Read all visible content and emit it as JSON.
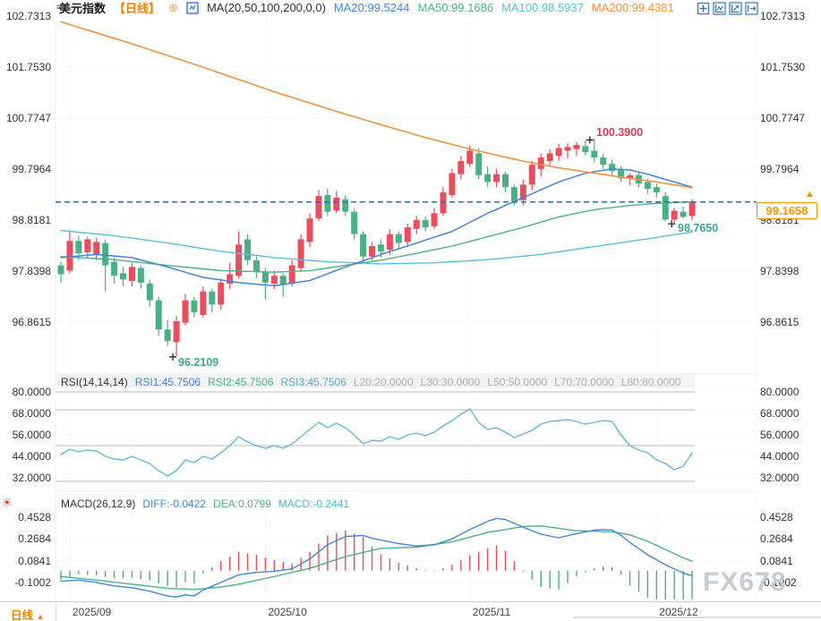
{
  "header": {
    "title": "美元指数",
    "period_tag": "【日线】",
    "ma_settings": "MA(20,50,100,200,0,0)",
    "ma20_label": "MA20:99.5244",
    "ma50_label": "MA50:99.1686",
    "ma100_label": "MA100:98.5937",
    "ma200_label": "MA200:99.4381"
  },
  "rsi_legend": {
    "name": "RSI(14,14,14)",
    "rsi1": "RSI1:45.7506",
    "rsi2": "RSI2:45.7506",
    "rsi3": "RSI3:45.7506",
    "l20": "L20:20.0000",
    "l30": "L30:30.0000",
    "l50": "L50:50.0000",
    "l70": "L70:70.0000",
    "l80": "L80:80.0000"
  },
  "macd_legend": {
    "name": "MACD(26,12,9)",
    "diff": "DIFF:-0.0422",
    "dea": "DEA:0.0799",
    "macd": "MACD:-0.2441"
  },
  "price_axis": {
    "ticks": [
      "102.7313",
      "101.7530",
      "100.7747",
      "99.7964",
      "98.8181",
      "97.8398",
      "96.8615"
    ]
  },
  "rsi_axis": {
    "ticks": [
      "80.0000",
      "68.0000",
      "56.0000",
      "44.0000",
      "32.0000"
    ]
  },
  "macd_axis": {
    "ticks": [
      "0.4528",
      "0.2684",
      "0.0841",
      "-0.1002"
    ]
  },
  "x_axis": {
    "labels": [
      "2025/09",
      "2025/10",
      "2025/11",
      "2025/12"
    ]
  },
  "bottom_bar": {
    "period": "日线",
    "arrow": "▲"
  },
  "annotations": {
    "current_price": "99.1658",
    "high": "100.3900",
    "low": "96.2109",
    "recent_low": "98.7650",
    "price_arrow": "▲",
    "live_icon": "☀",
    "menu_icon": "≡",
    "add_icon": "⊕"
  },
  "watermark": "FX678",
  "colors": {
    "up": "#ea4d5c",
    "down": "#4bb086",
    "ma20": "#4186e0",
    "ma50": "#4cb389",
    "ma100": "#5bbde6",
    "ma200": "#f5913d",
    "rsi": "#63b9dd",
    "diff": "#4186e0",
    "dea": "#4cb389",
    "current": "#1673e6",
    "grid": "#dcdcdc",
    "level": "#b8b8b8",
    "cross": "#222222"
  },
  "chart_data": {
    "type": "candlestick",
    "title": "美元指数 日线",
    "x_labels": [
      "2025/09",
      "2025/10",
      "2025/11",
      "2025/12"
    ],
    "x_label_indices": [
      1,
      23,
      46,
      67
    ],
    "price_ticks": [
      102.7313,
      101.753,
      100.7747,
      99.7964,
      98.8181,
      97.8398,
      96.8615
    ],
    "current_price": 99.1658,
    "candles": [
      [
        97.95,
        98.02,
        97.62,
        97.78
      ],
      [
        97.85,
        98.62,
        97.8,
        98.42
      ],
      [
        98.42,
        98.52,
        98.05,
        98.18
      ],
      [
        98.2,
        98.5,
        98.1,
        98.45
      ],
      [
        98.15,
        98.48,
        98.05,
        98.4
      ],
      [
        98.38,
        98.45,
        97.45,
        97.95
      ],
      [
        98.02,
        98.1,
        97.6,
        97.75
      ],
      [
        97.8,
        97.92,
        97.55,
        97.68
      ],
      [
        97.65,
        98.0,
        97.55,
        97.92
      ],
      [
        97.9,
        97.95,
        97.5,
        97.62
      ],
      [
        97.6,
        97.68,
        97.15,
        97.28
      ],
      [
        97.28,
        97.35,
        96.6,
        96.72
      ],
      [
        96.72,
        96.9,
        96.4,
        96.5
      ],
      [
        96.48,
        96.98,
        96.2109,
        96.88
      ],
      [
        96.85,
        97.4,
        96.8,
        97.28
      ],
      [
        97.28,
        97.35,
        96.95,
        97.05
      ],
      [
        97.0,
        97.55,
        96.95,
        97.45
      ],
      [
        97.45,
        97.5,
        97.05,
        97.2
      ],
      [
        97.2,
        97.7,
        97.1,
        97.62
      ],
      [
        97.6,
        98.0,
        97.5,
        97.78
      ],
      [
        97.75,
        98.6,
        97.7,
        98.35
      ],
      [
        98.45,
        98.55,
        97.95,
        98.05
      ],
      [
        98.05,
        98.12,
        97.7,
        97.82
      ],
      [
        97.82,
        97.9,
        97.3,
        97.62
      ],
      [
        97.6,
        97.85,
        97.5,
        97.75
      ],
      [
        97.75,
        97.8,
        97.35,
        97.58
      ],
      [
        97.6,
        98.05,
        97.55,
        97.95
      ],
      [
        97.9,
        98.55,
        97.85,
        98.45
      ],
      [
        98.4,
        98.95,
        98.3,
        98.85
      ],
      [
        98.85,
        99.4,
        98.8,
        99.28
      ],
      [
        99.3,
        99.42,
        98.9,
        98.98
      ],
      [
        99.0,
        99.38,
        98.95,
        99.25
      ],
      [
        99.22,
        99.3,
        98.9,
        98.98
      ],
      [
        98.98,
        99.05,
        98.45,
        98.55
      ],
      [
        98.55,
        98.6,
        97.98,
        98.12
      ],
      [
        98.12,
        98.4,
        98.02,
        98.32
      ],
      [
        98.35,
        98.45,
        98.1,
        98.22
      ],
      [
        98.25,
        98.65,
        98.15,
        98.55
      ],
      [
        98.55,
        98.6,
        98.25,
        98.38
      ],
      [
        98.4,
        98.75,
        98.3,
        98.68
      ],
      [
        98.65,
        98.9,
        98.55,
        98.82
      ],
      [
        98.82,
        98.9,
        98.6,
        98.68
      ],
      [
        98.7,
        99.05,
        98.65,
        98.95
      ],
      [
        98.95,
        99.45,
        98.9,
        99.35
      ],
      [
        99.3,
        99.8,
        99.25,
        99.72
      ],
      [
        99.7,
        100.05,
        99.6,
        99.95
      ],
      [
        99.9,
        100.25,
        99.85,
        100.15
      ],
      [
        100.1,
        100.2,
        99.6,
        99.68
      ],
      [
        99.7,
        99.85,
        99.45,
        99.55
      ],
      [
        99.55,
        99.8,
        99.45,
        99.7
      ],
      [
        99.7,
        99.75,
        99.35,
        99.45
      ],
      [
        99.45,
        99.5,
        99.1,
        99.18
      ],
      [
        99.2,
        99.6,
        99.1,
        99.5
      ],
      [
        99.5,
        99.95,
        99.4,
        99.88
      ],
      [
        99.8,
        100.1,
        99.65,
        100.02
      ],
      [
        99.95,
        100.18,
        99.85,
        100.1
      ],
      [
        100.05,
        100.28,
        99.95,
        100.2
      ],
      [
        100.15,
        100.3,
        100.0,
        100.22
      ],
      [
        100.18,
        100.32,
        100.05,
        100.26
      ],
      [
        100.24,
        100.35,
        100.06,
        100.12
      ],
      [
        100.15,
        100.39,
        99.92,
        100.02
      ],
      [
        100.02,
        100.1,
        99.8,
        99.88
      ],
      [
        99.9,
        99.98,
        99.68,
        99.76
      ],
      [
        99.8,
        99.85,
        99.55,
        99.62
      ],
      [
        99.62,
        99.72,
        99.48,
        99.68
      ],
      [
        99.68,
        99.74,
        99.45,
        99.52
      ],
      [
        99.55,
        99.62,
        99.32,
        99.42
      ],
      [
        99.45,
        99.52,
        99.25,
        99.35
      ],
      [
        99.28,
        99.36,
        98.8,
        98.83
      ],
      [
        98.83,
        99.05,
        98.765,
        99.0
      ],
      [
        98.98,
        99.08,
        98.85,
        98.88
      ],
      [
        98.9,
        99.22,
        98.82,
        99.1658
      ]
    ],
    "ma20_points": [
      [
        0,
        98.1
      ],
      [
        4,
        98.16
      ],
      [
        8,
        98.1
      ],
      [
        12,
        97.92
      ],
      [
        16,
        97.72
      ],
      [
        20,
        97.62
      ],
      [
        24,
        97.56
      ],
      [
        28,
        97.66
      ],
      [
        32,
        97.92
      ],
      [
        36,
        98.16
      ],
      [
        40,
        98.38
      ],
      [
        44,
        98.6
      ],
      [
        48,
        98.95
      ],
      [
        52,
        99.25
      ],
      [
        56,
        99.55
      ],
      [
        59,
        99.72
      ],
      [
        62,
        99.8
      ],
      [
        64,
        99.78
      ],
      [
        66,
        99.7
      ],
      [
        68,
        99.6
      ],
      [
        70,
        99.5
      ],
      [
        71,
        99.45
      ]
    ],
    "ma50_points": [
      [
        0,
        98.12
      ],
      [
        6,
        98.06
      ],
      [
        12,
        97.95
      ],
      [
        18,
        97.85
      ],
      [
        24,
        97.82
      ],
      [
        28,
        97.85
      ],
      [
        32,
        97.95
      ],
      [
        36,
        98.05
      ],
      [
        40,
        98.18
      ],
      [
        44,
        98.32
      ],
      [
        48,
        98.5
      ],
      [
        52,
        98.68
      ],
      [
        56,
        98.88
      ],
      [
        60,
        99.02
      ],
      [
        64,
        99.1
      ],
      [
        67,
        99.14
      ],
      [
        71,
        99.17
      ]
    ],
    "ma100_points": [
      [
        0,
        98.62
      ],
      [
        6,
        98.52
      ],
      [
        12,
        98.38
      ],
      [
        18,
        98.22
      ],
      [
        24,
        98.1
      ],
      [
        30,
        98.02
      ],
      [
        36,
        97.98
      ],
      [
        42,
        98.0
      ],
      [
        48,
        98.06
      ],
      [
        54,
        98.16
      ],
      [
        58,
        98.26
      ],
      [
        62,
        98.36
      ],
      [
        66,
        98.46
      ],
      [
        69,
        98.54
      ],
      [
        71,
        98.59
      ]
    ],
    "ma200_points": [
      [
        0,
        102.62
      ],
      [
        8,
        102.2
      ],
      [
        16,
        101.75
      ],
      [
        24,
        101.28
      ],
      [
        32,
        100.85
      ],
      [
        40,
        100.45
      ],
      [
        46,
        100.18
      ],
      [
        52,
        99.95
      ],
      [
        56,
        99.82
      ],
      [
        60,
        99.72
      ],
      [
        64,
        99.62
      ],
      [
        67,
        99.55
      ],
      [
        71,
        99.44
      ]
    ],
    "rsi": {
      "ticks": [
        80,
        68,
        56,
        44,
        32
      ],
      "levels": [
        80,
        70,
        50,
        30
      ],
      "level_labels": [
        20,
        30,
        50,
        70,
        80
      ],
      "values": [
        45,
        48,
        46.5,
        47.5,
        47,
        44,
        42.5,
        42,
        44,
        42,
        40,
        36,
        33,
        36,
        42,
        40.5,
        44,
        42.5,
        46,
        50,
        55,
        52,
        50,
        48.5,
        50,
        48.5,
        51,
        55,
        59,
        63,
        60,
        62.5,
        60,
        56,
        51,
        53,
        52.5,
        55,
        53.5,
        56,
        57,
        55.5,
        57.5,
        61,
        64,
        67.5,
        70.5,
        63,
        59,
        60,
        57.5,
        54.5,
        56.5,
        58.5,
        62,
        63.5,
        64,
        64.5,
        63.5,
        62,
        63,
        64,
        63.5,
        56,
        50,
        47.5,
        46,
        42,
        40,
        36.5,
        38.5,
        45.75
      ]
    },
    "macd": {
      "ticks": [
        0.4528,
        0.2684,
        0.0841,
        -0.1002
      ],
      "diff_points": [
        [
          0,
          -0.09
        ],
        [
          2,
          -0.08
        ],
        [
          4,
          -0.1
        ],
        [
          6,
          -0.13
        ],
        [
          8,
          -0.145
        ],
        [
          10,
          -0.175
        ],
        [
          12,
          -0.215
        ],
        [
          13,
          -0.225
        ],
        [
          14,
          -0.205
        ],
        [
          15,
          -0.215
        ],
        [
          16,
          -0.165
        ],
        [
          18,
          -0.1
        ],
        [
          20,
          -0.035
        ],
        [
          22,
          -0.015
        ],
        [
          24,
          -0.005
        ],
        [
          26,
          0.015
        ],
        [
          28,
          0.1
        ],
        [
          30,
          0.22
        ],
        [
          32,
          0.29
        ],
        [
          34,
          0.3
        ],
        [
          35,
          0.275
        ],
        [
          36,
          0.26
        ],
        [
          38,
          0.23
        ],
        [
          40,
          0.21
        ],
        [
          42,
          0.22
        ],
        [
          44,
          0.27
        ],
        [
          46,
          0.35
        ],
        [
          48,
          0.42
        ],
        [
          49,
          0.445
        ],
        [
          50,
          0.435
        ],
        [
          52,
          0.37
        ],
        [
          54,
          0.31
        ],
        [
          56,
          0.28
        ],
        [
          58,
          0.315
        ],
        [
          60,
          0.345
        ],
        [
          61,
          0.35
        ],
        [
          62,
          0.345
        ],
        [
          63,
          0.3
        ],
        [
          64,
          0.24
        ],
        [
          66,
          0.135
        ],
        [
          68,
          0.05
        ],
        [
          70,
          -0.02
        ],
        [
          71,
          -0.042
        ]
      ],
      "dea_points": [
        [
          0,
          -0.05
        ],
        [
          4,
          -0.08
        ],
        [
          8,
          -0.115
        ],
        [
          12,
          -0.15
        ],
        [
          15,
          -0.16
        ],
        [
          18,
          -0.14
        ],
        [
          20,
          -0.115
        ],
        [
          24,
          -0.05
        ],
        [
          28,
          0.02
        ],
        [
          32,
          0.12
        ],
        [
          36,
          0.19
        ],
        [
          40,
          0.2
        ],
        [
          44,
          0.245
        ],
        [
          48,
          0.325
        ],
        [
          52,
          0.375
        ],
        [
          54,
          0.38
        ],
        [
          56,
          0.36
        ],
        [
          58,
          0.34
        ],
        [
          60,
          0.335
        ],
        [
          62,
          0.33
        ],
        [
          64,
          0.305
        ],
        [
          66,
          0.25
        ],
        [
          68,
          0.18
        ],
        [
          70,
          0.11
        ],
        [
          71,
          0.08
        ]
      ],
      "histogram_rule": "2*(DIFF-DEA)"
    },
    "high_marker": {
      "index": 60,
      "value": 100.39
    },
    "low_marker": {
      "index": 13,
      "value": 96.2109
    },
    "recent_low_marker": {
      "index": 69,
      "value": 98.765
    }
  }
}
